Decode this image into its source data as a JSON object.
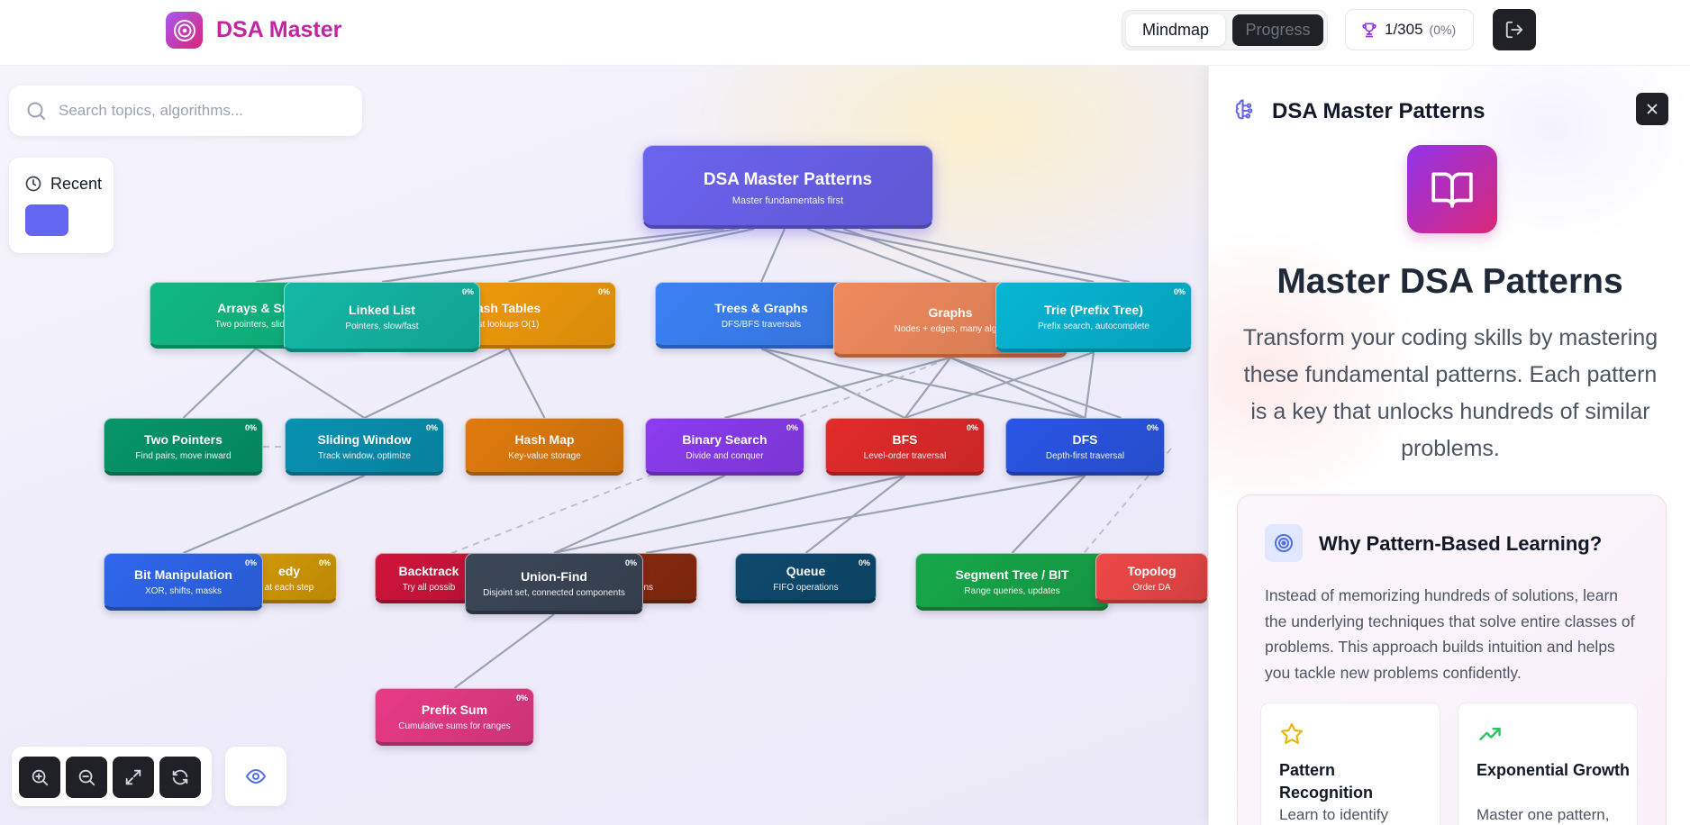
{
  "app": {
    "title": "DSA Master",
    "logo_icon": "target-icon"
  },
  "header": {
    "tabs": [
      {
        "label": "Mindmap",
        "active": true
      },
      {
        "label": "Progress",
        "active": false
      }
    ],
    "score": {
      "value": "1/305",
      "percent": "(0%)",
      "icon": "trophy-icon"
    },
    "logout_icon": "logout-icon"
  },
  "search": {
    "placeholder": "Search topics, algorithms..."
  },
  "recent": {
    "label": "Recent",
    "swatch_color": "#6366f1"
  },
  "controls": {
    "buttons": [
      "zoom-in-icon",
      "zoom-out-icon",
      "fit-screen-icon",
      "refresh-icon"
    ],
    "view_icon": "eye-icon"
  },
  "mindmap": {
    "root": {
      "title": "DSA Master Patterns",
      "subtitle": "Master fundamentals first"
    },
    "nodes": [
      {
        "id": "arrays",
        "title": "Arrays & Stri",
        "subtitle": "Two pointers, sliding",
        "pct": "",
        "color": "#10b981"
      },
      {
        "id": "hash-tables",
        "title": "ash Tables",
        "subtitle": "st lookups O(1)",
        "pct": "0%",
        "color": "#f59e0b"
      },
      {
        "id": "linked-list",
        "title": "Linked List",
        "subtitle": "Pointers, slow/fast",
        "pct": "0%",
        "color": "#14b8a6"
      },
      {
        "id": "trees-graphs",
        "title": "Trees & Graphs",
        "subtitle": "DFS/BFS traversals",
        "pct": "",
        "color": "#3b82f6"
      },
      {
        "id": "graphs",
        "title": "Graphs",
        "subtitle": "Nodes + edges, many algori",
        "pct": "",
        "color": "#f08a5d"
      },
      {
        "id": "trie",
        "title": "Trie (Prefix Tree)",
        "subtitle": "Prefix search, autocomplete",
        "pct": "0%",
        "color": "#06b6d4"
      },
      {
        "id": "two-pointers",
        "title": "Two Pointers",
        "subtitle": "Find pairs, move inward",
        "pct": "0%",
        "color": "#059669"
      },
      {
        "id": "sliding-window",
        "title": "Sliding Window",
        "subtitle": "Track window, optimize",
        "pct": "0%",
        "color": "#0891b2"
      },
      {
        "id": "hash-map",
        "title": "Hash Map",
        "subtitle": "Key-value storage",
        "pct": "",
        "color": "#e07b0c"
      },
      {
        "id": "binary-search",
        "title": "Binary Search",
        "subtitle": "Divide and conquer",
        "pct": "0%",
        "color": "#8b3cf0"
      },
      {
        "id": "bfs",
        "title": "BFS",
        "subtitle": "Level-order traversal",
        "pct": "0%",
        "color": "#e32b2b"
      },
      {
        "id": "dfs",
        "title": "DFS",
        "subtitle": "Depth-first traversal",
        "pct": "0%",
        "color": "#2a56e6"
      },
      {
        "id": "greedy",
        "title": "edy",
        "subtitle": "at each step",
        "pct": "0%",
        "color": "#d49a06"
      },
      {
        "id": "bit-manipulation",
        "title": "Bit Manipulation",
        "subtitle": "XOR, shifts, masks",
        "pct": "0%",
        "color": "#2f66ee"
      },
      {
        "id": "backtracking",
        "title": "Backtrack",
        "subtitle": "Try all possib",
        "pct": "",
        "color": "#d0143c"
      },
      {
        "id": "dp",
        "title": "",
        "subtitle": "ons",
        "pct": "",
        "color": "#8b2a10"
      },
      {
        "id": "union-find",
        "title": "Union-Find",
        "subtitle": "Disjoint set, connected components",
        "pct": "0%",
        "color": "#3b4657"
      },
      {
        "id": "queue",
        "title": "Queue",
        "subtitle": "FIFO operations",
        "pct": "0%",
        "color": "#0e4a6e"
      },
      {
        "id": "segment-tree",
        "title": "Segment Tree / BIT",
        "subtitle": "Range queries, updates",
        "pct": "",
        "color": "#17a84a"
      },
      {
        "id": "topological",
        "title": "Topolog",
        "subtitle": "Order DA",
        "pct": "",
        "color": "#f04848"
      },
      {
        "id": "prefix-sum",
        "title": "Prefix Sum",
        "subtitle": "Cumulative sums for ranges",
        "pct": "0%",
        "color": "#e83a86"
      }
    ]
  },
  "panel": {
    "header": "DSA Master Patterns",
    "header_icon": "brain-icon",
    "close_icon": "close-icon",
    "hero_icon": "book-icon",
    "title": "Master DSA Patterns",
    "description": "Transform your coding skills by mastering these fundamental patterns. Each pattern is a key that unlocks hundreds of similar problems.",
    "why": {
      "icon": "target-icon",
      "title": "Why Pattern-Based Learning?",
      "text": "Instead of memorizing hundreds of solutions, learn the underlying techniques that solve entire classes of problems. This approach builds intuition and helps you tackle new problems confidently."
    },
    "features": [
      {
        "icon": "star-icon",
        "title": "Pattern Recognition",
        "text": "Learn to identify"
      },
      {
        "icon": "trending-up-icon",
        "title": "Exponential Growth",
        "text": "Master one pattern, solve dozens of"
      }
    ]
  }
}
